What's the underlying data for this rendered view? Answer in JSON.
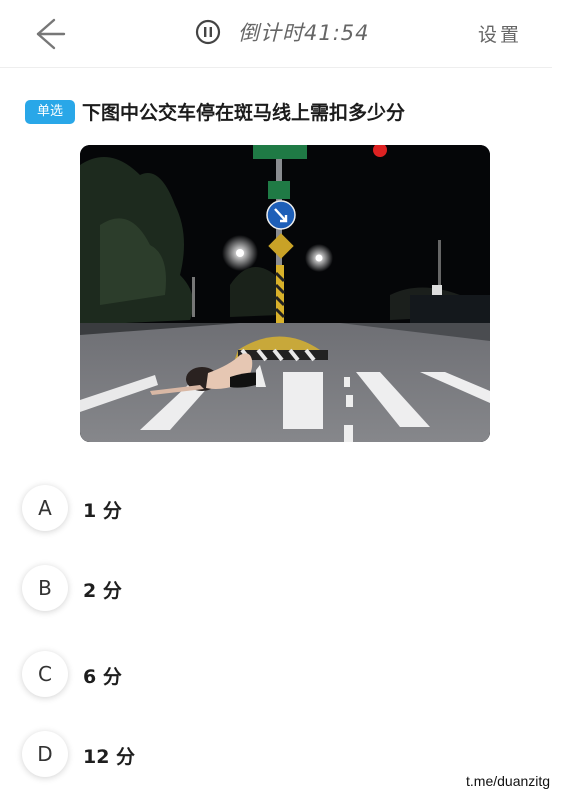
{
  "header": {
    "back_icon": "arrow-left-icon",
    "pause_icon": "pause-circle-icon",
    "timer_label": "倒计时41:54",
    "settings_label": "设置"
  },
  "question": {
    "type_badge": "单选",
    "text": "下图中公交车停在斑马线上需扣多少分",
    "image_alt": "Night street photo: a person lying on a zebra crossing in front of a traffic island"
  },
  "options": [
    {
      "letter": "A",
      "text": "1 分"
    },
    {
      "letter": "B",
      "text": "2 分"
    },
    {
      "letter": "C",
      "text": "6 分"
    },
    {
      "letter": "D",
      "text": "12 分"
    }
  ],
  "watermark": "t.me/duanzitg",
  "colors": {
    "badge": "#29a7e8",
    "icon_gray": "#666666"
  }
}
